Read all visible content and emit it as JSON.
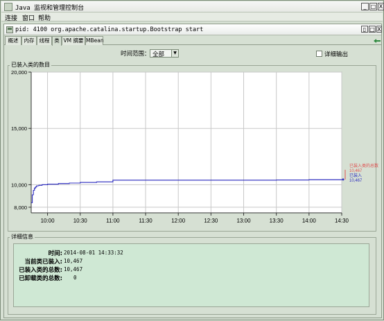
{
  "window": {
    "title": "Java 监视和管理控制台",
    "min": "_",
    "max": "□",
    "close": "X"
  },
  "menu": [
    "连接",
    "窗口",
    "帮助"
  ],
  "inner_window": {
    "title": "pid: 4100 org.apache.catalina.startup.Bootstrap start",
    "restore": "▯",
    "max": "□",
    "close": "X"
  },
  "tabs": [
    "概述",
    "内存",
    "线程",
    "类",
    "VM 摘要",
    "MBean"
  ],
  "active_tab": "类",
  "range": {
    "label": "时间范围：",
    "value": "全部"
  },
  "verbose": {
    "label": "详细输出",
    "checked": false
  },
  "chart_group_label": "已装入类的数目",
  "chart_data": {
    "type": "line",
    "title": "",
    "xlabel": "",
    "ylabel": "",
    "x_ticks": [
      "10:00",
      "10:30",
      "11:00",
      "11:30",
      "12:00",
      "12:30",
      "13:00",
      "13:30",
      "14:00",
      "14:30"
    ],
    "y_ticks": [
      "20,000",
      "15,000",
      "10,000",
      "8,000"
    ],
    "y_tick_values": [
      20000,
      15000,
      10000,
      8000
    ],
    "ylim": [
      7500,
      20000
    ],
    "x_minutes": [
      -15,
      -14,
      -13,
      -12,
      -11,
      -10,
      -8,
      -5,
      0,
      10,
      20,
      30,
      45,
      60,
      90,
      120,
      150,
      180,
      210,
      240,
      270
    ],
    "series": [
      {
        "name": "已装入类的总数",
        "color": "#e05050",
        "values": [
          8400,
          9100,
          9500,
          9700,
          9800,
          9900,
          9950,
          10000,
          10050,
          10100,
          10150,
          10200,
          10250,
          10400,
          10400,
          10400,
          10400,
          10400,
          10420,
          10440,
          10467
        ]
      },
      {
        "name": "已装入",
        "color": "#3030c0",
        "values": [
          8400,
          9100,
          9500,
          9700,
          9800,
          9900,
          9950,
          10000,
          10050,
          10100,
          10150,
          10200,
          10250,
          10400,
          10400,
          10400,
          10400,
          10400,
          10420,
          10440,
          10467
        ]
      }
    ],
    "legend_values": [
      "10,467",
      "10,467"
    ],
    "legend_position": "right"
  },
  "details": {
    "group_label": "详细信息",
    "rows": [
      {
        "label": "时间:",
        "value": "2014-08-01 14:33:32"
      },
      {
        "label": "当前类已装入:",
        "value": "10,467"
      },
      {
        "label": "已装入类的总数:",
        "value": "10,467"
      },
      {
        "label": "已卸载类的总数:",
        "value": "0"
      }
    ]
  }
}
